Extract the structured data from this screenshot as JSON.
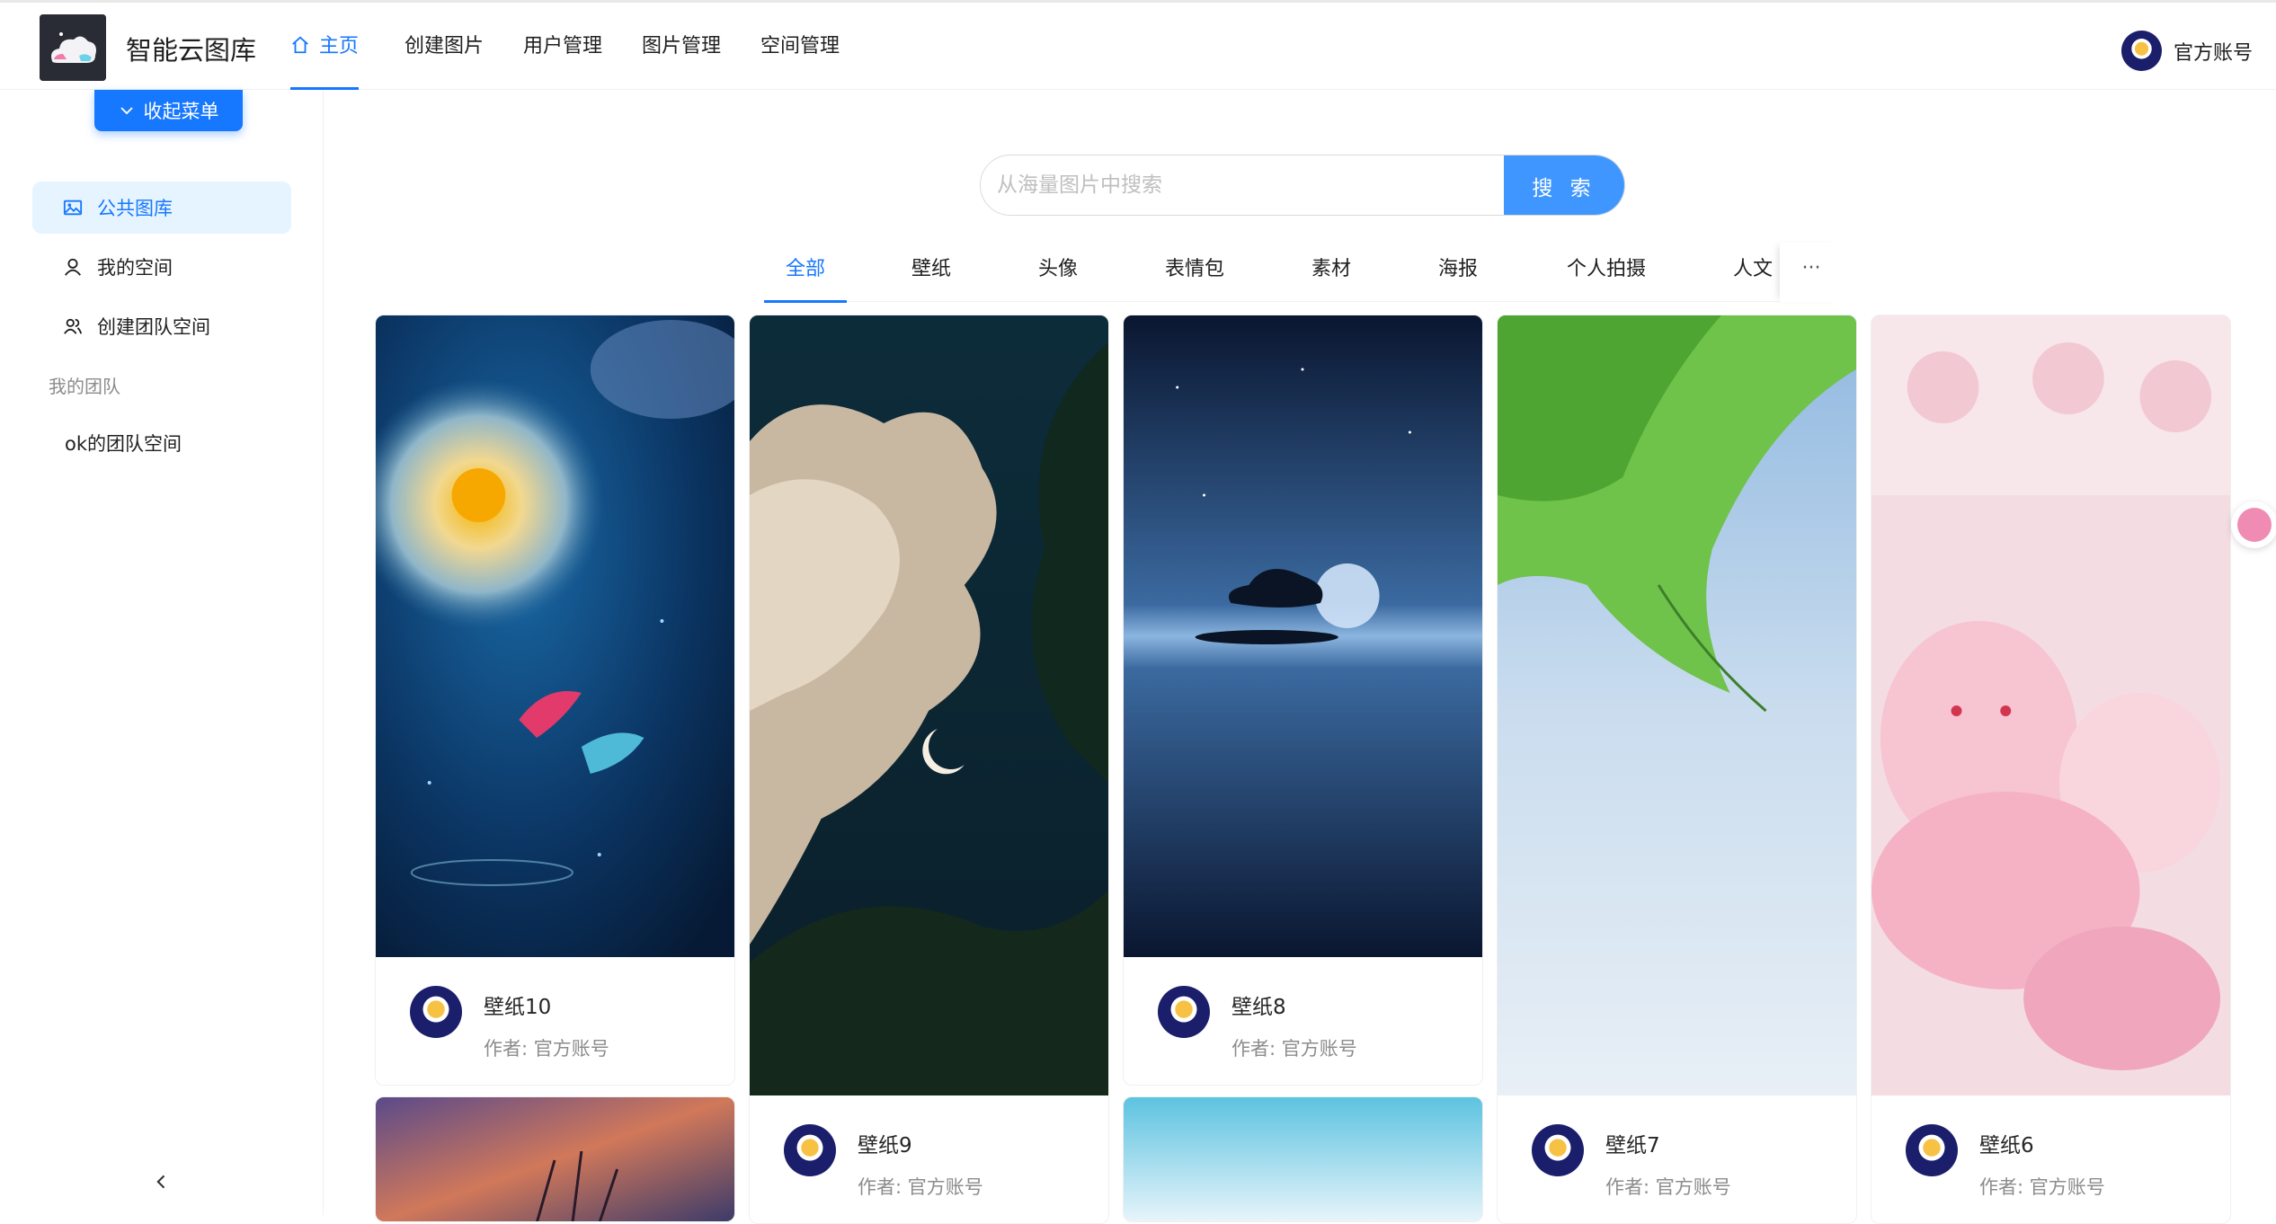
{
  "header": {
    "site_title": "智能云图库",
    "nav": [
      "主页",
      "创建图片",
      "用户管理",
      "图片管理",
      "空间管理"
    ],
    "user_name": "官方账号"
  },
  "sidebar": {
    "collapse_label": "收起菜单",
    "items": [
      {
        "label": "公共图库",
        "icon": "picture-icon",
        "active": true
      },
      {
        "label": "我的空间",
        "icon": "user-icon",
        "active": false
      },
      {
        "label": "创建团队空间",
        "icon": "team-icon",
        "active": false
      }
    ],
    "group_title": "我的团队",
    "team_items": [
      "ok的团队空间"
    ]
  },
  "search": {
    "placeholder": "从海量图片中搜索",
    "button_label": "搜 索"
  },
  "tabs": [
    "全部",
    "壁纸",
    "头像",
    "表情包",
    "素材",
    "海报",
    "个人拍摄",
    "人文"
  ],
  "tabs_more": "···",
  "cards": [
    {
      "title": "壁纸10",
      "author": "作者: 官方账号",
      "image": "koi-fish-flower-wallpaper"
    },
    {
      "title": "壁纸9",
      "author": "作者: 官方账号",
      "image": "clouds-moon-fern-wallpaper"
    },
    {
      "title": "壁纸8",
      "author": "作者: 官方账号",
      "image": "tree-island-moon-wallpaper"
    },
    {
      "title": "壁纸7",
      "author": "作者: 官方账号",
      "image": "green-leaves-sky-wallpaper"
    },
    {
      "title": "壁纸6",
      "author": "作者: 官方账号",
      "image": "pink-plush-toys-wallpaper"
    }
  ],
  "colors": {
    "primary": "#1677ff",
    "primary_light": "#e6f4ff",
    "search_button": "#4096ff"
  }
}
